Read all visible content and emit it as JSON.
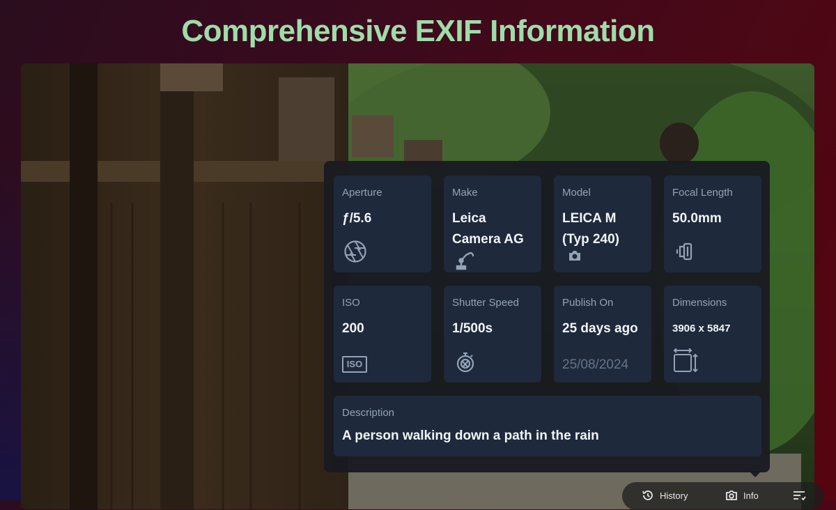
{
  "headline": "Comprehensive EXIF Information",
  "exif": {
    "aperture": {
      "label": "Aperture",
      "value": "ƒ/5.6",
      "icon": "aperture-icon"
    },
    "make": {
      "label": "Make",
      "value_line1": "Leica",
      "value_line2": "Camera AG",
      "icon": "robot-arm-icon"
    },
    "model": {
      "label": "Model",
      "value_line1": "LEICA M",
      "value_line2": "(Typ 240)",
      "icon": "camera-icon"
    },
    "focal_length": {
      "label": "Focal Length",
      "value": "50.0mm",
      "icon": "lens-icon"
    },
    "iso": {
      "label": "ISO",
      "value": "200",
      "icon_text": "ISO"
    },
    "shutter": {
      "label": "Shutter Speed",
      "value": "1/500s",
      "icon": "stopwatch-icon"
    },
    "publish": {
      "label": "Publish On",
      "value": "25 days ago",
      "date": "25/08/2024"
    },
    "dimensions": {
      "label": "Dimensions",
      "value": "3906 x 5847",
      "icon": "dimensions-icon"
    },
    "description": {
      "label": "Description",
      "value": "A person walking down a path in the rain"
    }
  },
  "toolbar": {
    "history": "History",
    "info": "Info"
  },
  "colors": {
    "headline": "#9fdcaa",
    "card": "#1e293b",
    "panel": "#181a20"
  }
}
